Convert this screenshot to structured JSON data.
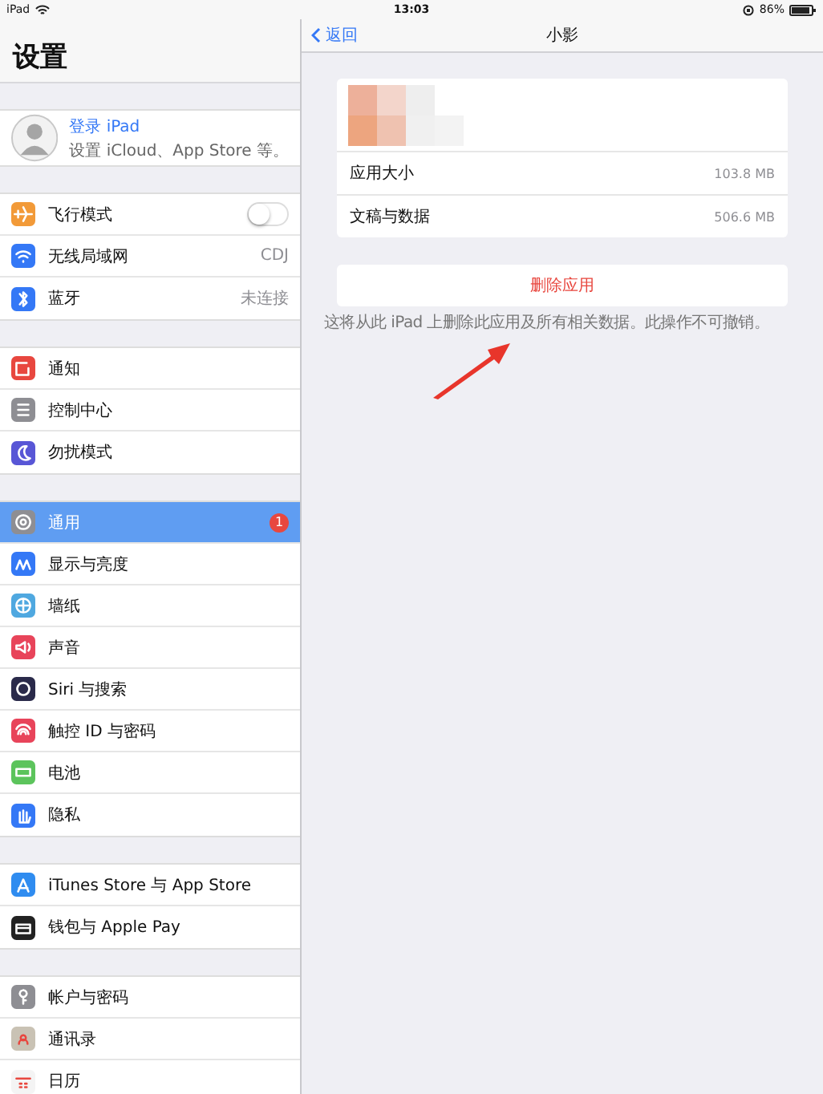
{
  "status_bar": {
    "device": "iPad",
    "time": "13:03",
    "battery": "86%"
  },
  "sidebar": {
    "title": "设置",
    "profile": {
      "name": "登录 iPad",
      "subtitle": "设置 iCloud、App Store 等。"
    },
    "groups": [
      {
        "items": [
          {
            "label": "飞行模式",
            "color": "#f29a38",
            "kind": "toggle",
            "on": false,
            "selected": false
          },
          {
            "label": "无线局域网",
            "color": "#3478f6",
            "kind": "value",
            "value": "CDJ",
            "selected": false
          },
          {
            "label": "蓝牙",
            "color": "#3478f6",
            "kind": "value",
            "value": "未连接",
            "selected": false
          }
        ]
      },
      {
        "items": [
          {
            "label": "通知",
            "color": "#e8473f",
            "kind": "plain",
            "selected": false
          },
          {
            "label": "控制中心",
            "color": "#8e8e93",
            "kind": "plain",
            "selected": false
          },
          {
            "label": "勿扰模式",
            "color": "#5856d6",
            "kind": "plain",
            "selected": false
          }
        ]
      },
      {
        "items": [
          {
            "label": "通用",
            "color": "#8e8e93",
            "kind": "badge",
            "badge": "1",
            "selected": true
          },
          {
            "label": "显示与亮度",
            "color": "#3478f6",
            "kind": "plain",
            "selected": false
          },
          {
            "label": "墙纸",
            "color": "#4fa8e0",
            "kind": "plain",
            "selected": false
          },
          {
            "label": "声音",
            "color": "#e8445a",
            "kind": "plain",
            "selected": false
          },
          {
            "label": "Siri 与搜索",
            "color": "#2a2a4a",
            "kind": "plain",
            "selected": false
          },
          {
            "label": "触控 ID 与密码",
            "color": "#e8445a",
            "kind": "plain",
            "selected": false
          },
          {
            "label": "电池",
            "color": "#5cc45c",
            "kind": "plain",
            "selected": false
          },
          {
            "label": "隐私",
            "color": "#3478f6",
            "kind": "plain",
            "selected": false
          }
        ]
      },
      {
        "items": [
          {
            "label": "iTunes Store 与 App Store",
            "color": "#2f8cf0",
            "kind": "plain",
            "selected": false
          },
          {
            "label": "钱包与 Apple Pay",
            "color": "#222222",
            "kind": "plain",
            "selected": false
          }
        ]
      },
      {
        "items": [
          {
            "label": "帐户与密码",
            "color": "#8e8e93",
            "kind": "plain",
            "selected": false
          },
          {
            "label": "通讯录",
            "color": "#c9c2b4",
            "kind": "plain",
            "selected": false
          },
          {
            "label": "日历",
            "color": "#f4f4f4",
            "kind": "plain",
            "selected": false
          }
        ]
      }
    ]
  },
  "detail": {
    "back": "返回",
    "title": "小影",
    "rows": [
      {
        "label": "应用大小",
        "value": "103.8 MB"
      },
      {
        "label": "文稿与数据",
        "value": "506.6 MB"
      }
    ],
    "delete_button": "删除应用",
    "footnote": "这将从此 iPad 上删除此应用及所有相关数据。此操作不可撤销。"
  }
}
